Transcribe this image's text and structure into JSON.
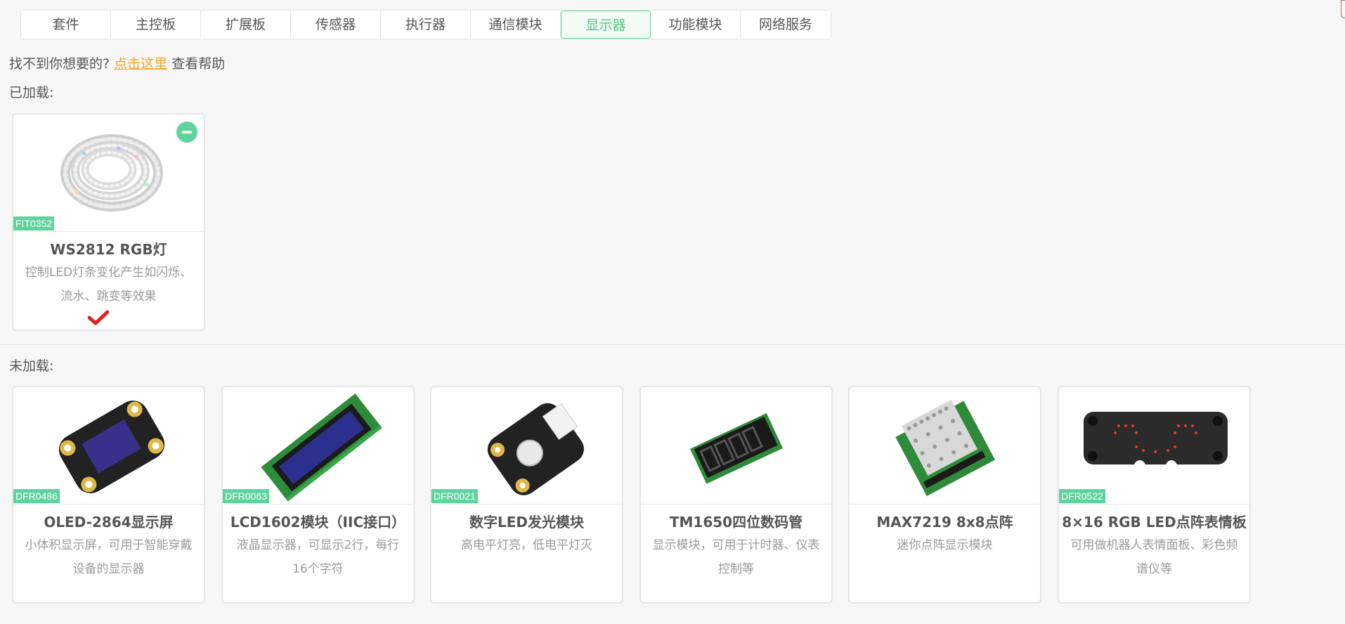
{
  "tabs": [
    {
      "label": "套件"
    },
    {
      "label": "主控板"
    },
    {
      "label": "扩展板"
    },
    {
      "label": "传感器"
    },
    {
      "label": "执行器"
    },
    {
      "label": "通信模块"
    },
    {
      "label": "显示器",
      "active": true
    },
    {
      "label": "功能模块"
    },
    {
      "label": "网络服务"
    }
  ],
  "help": {
    "prefix": "找不到你想要的?",
    "link": "点击这里",
    "suffix": " 查看帮助"
  },
  "loaded": {
    "label": "已加载:",
    "items": [
      {
        "sku": "FIT0352",
        "title": "WS2812 RGB灯",
        "desc": "控制LED灯条变化产生如闪烁、流水、跳变等效果",
        "icon": "led-strip-image",
        "selected": true
      }
    ]
  },
  "unloaded": {
    "label": "未加载:",
    "items": [
      {
        "sku": "DFR0486",
        "title": "OLED-2864显示屏",
        "desc": "小体积显示屏，可用于智能穿戴设备的显示器",
        "icon": "oled-display-image"
      },
      {
        "sku": "DFR0063",
        "title": "LCD1602模块（IIC接口）",
        "desc": "液晶显示器，可显示2行，每行16个字符",
        "icon": "lcd1602-image"
      },
      {
        "sku": "DFR0021",
        "title": "数字LED发光模块",
        "desc": "高电平灯亮，低电平灯灭",
        "icon": "digital-led-module-image"
      },
      {
        "sku": "",
        "title": "TM1650四位数码管",
        "desc": "显示模块，可用于计时器、仪表控制等",
        "icon": "seven-segment-image"
      },
      {
        "sku": "",
        "title": "MAX7219 8x8点阵",
        "desc": "迷你点阵显示模块",
        "icon": "dot-matrix-image"
      },
      {
        "sku": "DFR0522",
        "title": "8×16 RGB LED点阵表情板",
        "desc": "可用做机器人表情面板、彩色频谱仪等",
        "icon": "led-matrix-face-image"
      }
    ]
  },
  "colors": {
    "accent": "#5fd39c",
    "link": "#f5a623",
    "check": "#e02020"
  }
}
